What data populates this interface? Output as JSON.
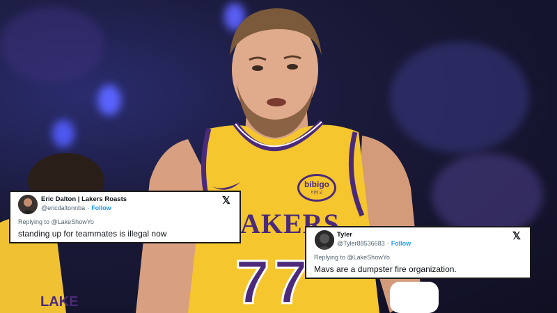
{
  "jersey": {
    "team_text": "AKERS",
    "number": "77",
    "patch": "bibigo",
    "patch_sub": "비비고"
  },
  "tweets": [
    {
      "name": "Eric Dalton | Lakers Roasts",
      "handle": "@ericdaltonnba",
      "follow": "Follow",
      "replying_to": "Replying to @LakeShowYo",
      "text": "standing up for teammates is illegal now",
      "platform_icon": "x-logo-icon"
    },
    {
      "name": "Tyler",
      "handle": "@Tyler88536683",
      "follow": "Follow",
      "replying_to": "Replying to @LakeShowYo",
      "text": "Mavs are a dumpster fire organization.",
      "platform_icon": "x-logo-icon"
    }
  ],
  "colors": {
    "jersey_gold": "#f5c62d",
    "jersey_purple": "#4b2a7b",
    "follow_blue": "#1d9bf0"
  }
}
